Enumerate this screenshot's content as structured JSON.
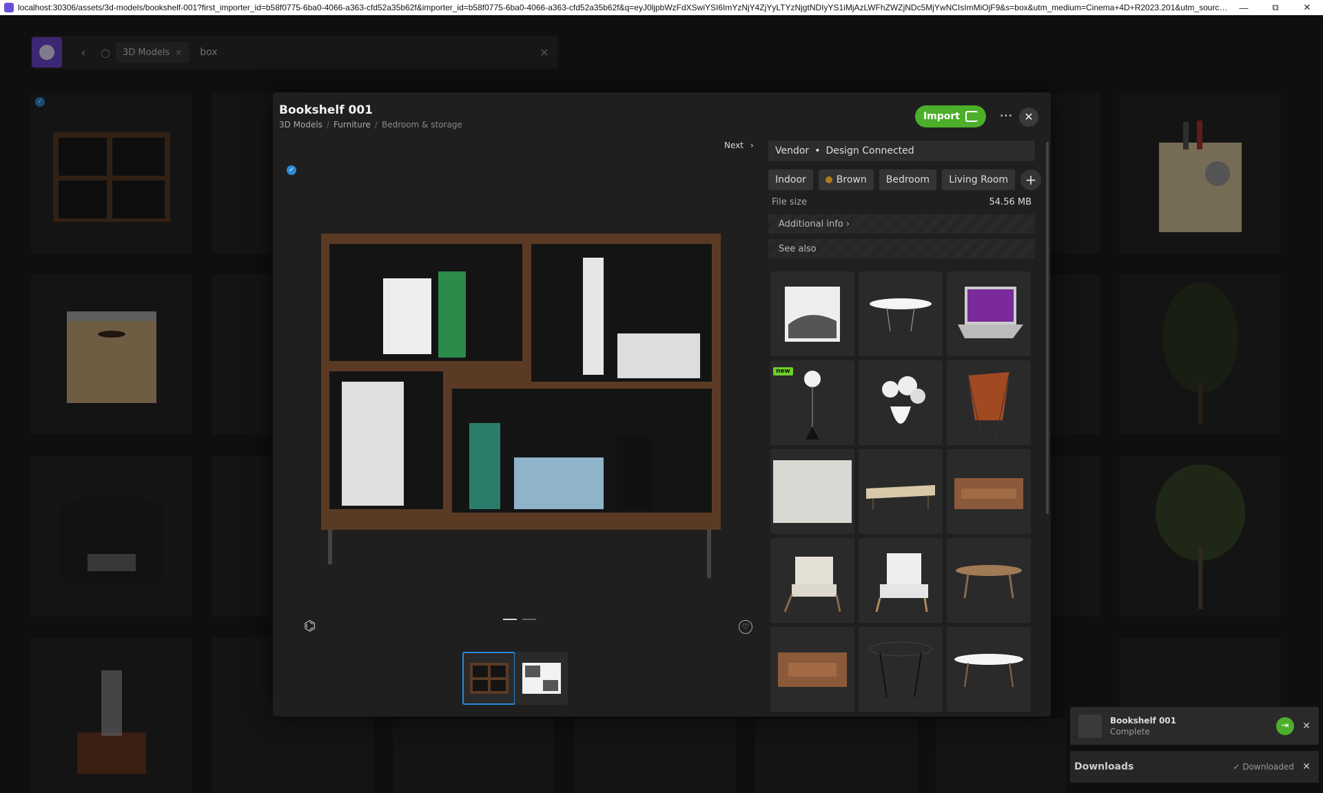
{
  "window": {
    "url": "localhost:30306/assets/3d-models/bookshelf-001?first_importer_id=b58f0775-6ba0-4066-a363-cfd52a35b62f&importer_id=b58f0775-6ba0-4066-a363-cfd52a35b62f&q=eyJ0ljpbWzFdXSwiYSI6ImYzNjY4ZjYyLTYzNjgtNDIyYS1iMjAzLWFhZWZjNDc5MjYwNCIsImMiOjF9&s=box&utm_medium=Cinema+4D+R2023.201&utm_source=...",
    "minimize": "—",
    "maximize": "⧉",
    "close": "✕"
  },
  "search": {
    "back_icon": "chevron-left-icon",
    "chip_label": "3D Models",
    "chip_remove": "×",
    "query": "box",
    "clear": "✕"
  },
  "modal": {
    "title": "Bookshelf 001",
    "breadcrumb": [
      "3D Models",
      "Furniture",
      "Bedroom & storage"
    ],
    "import_label": "Import",
    "more": "···",
    "close": "✕",
    "next_label": "Next",
    "next_arrow": "›",
    "vendor_label": "Vendor",
    "vendor_value": "Design Connected",
    "tags": [
      "Indoor",
      "Brown",
      "Bedroom",
      "Living Room"
    ],
    "tag_add": "+",
    "file_size_label": "File size",
    "file_size_value": "54.56 MB",
    "additional_info": "Additional info ›",
    "see_also": "See also",
    "new_badge": "new",
    "fav_icon": "♡",
    "ar_icon": "⌬"
  },
  "downloads": {
    "item_name": "Bookshelf 001",
    "item_status": "Complete",
    "title": "Downloads",
    "status": "✓ Downloaded",
    "close": "✕"
  },
  "colors": {
    "accent": "#4caf2a",
    "brand": "#6d4ad0",
    "selection": "#2a8ad9"
  }
}
